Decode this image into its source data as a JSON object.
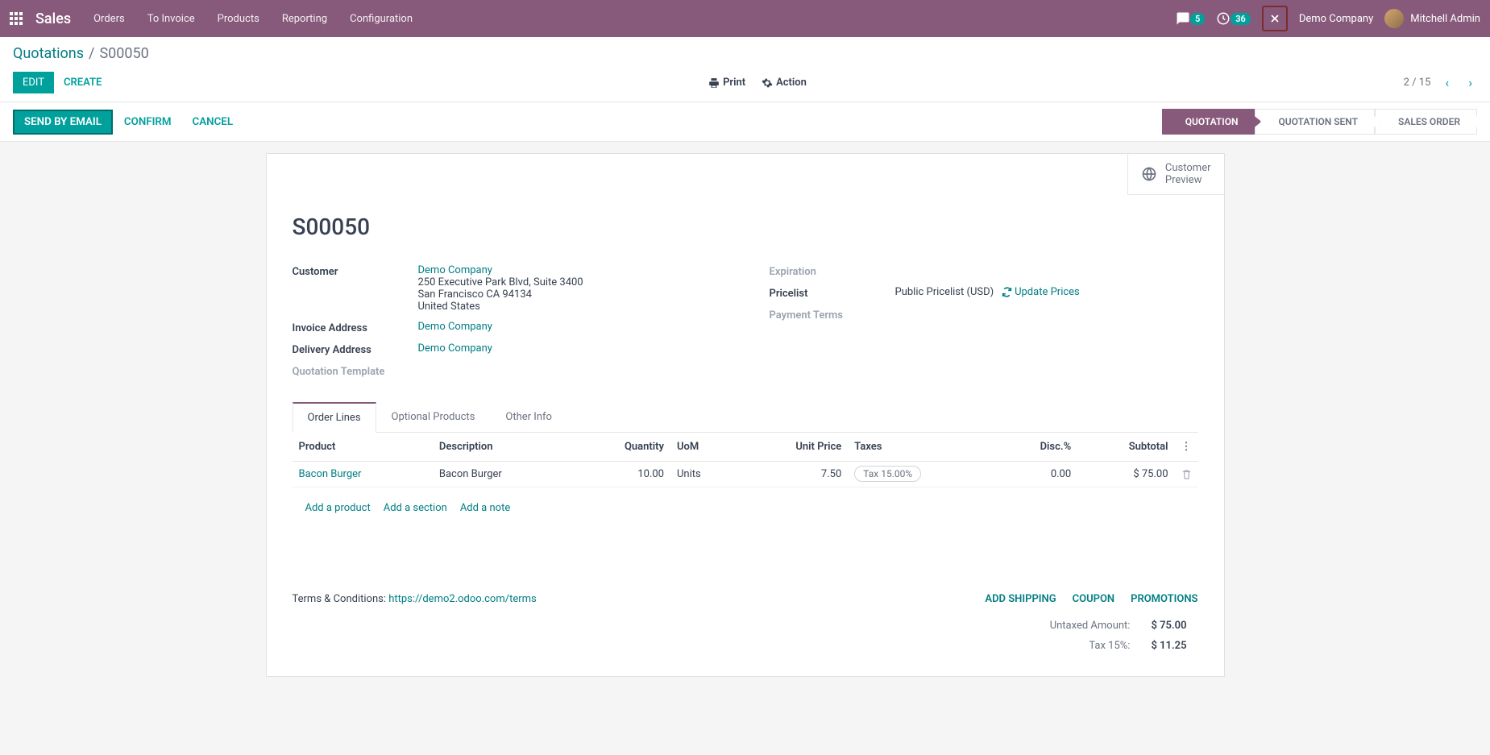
{
  "navbar": {
    "app": "Sales",
    "menu": [
      "Orders",
      "To Invoice",
      "Products",
      "Reporting",
      "Configuration"
    ],
    "msg_count": "5",
    "activity_count": "36",
    "company": "Demo Company",
    "user": "Mitchell Admin"
  },
  "breadcrumb": {
    "parent": "Quotations",
    "sep": "/",
    "current": "S00050"
  },
  "buttons": {
    "edit": "EDIT",
    "create": "CREATE",
    "print": "Print",
    "action": "Action"
  },
  "pager": {
    "text": "2 / 15"
  },
  "status": {
    "send": "SEND BY EMAIL",
    "confirm": "CONFIRM",
    "cancel": "CANCEL",
    "steps": [
      "QUOTATION",
      "QUOTATION SENT",
      "SALES ORDER"
    ]
  },
  "preview": {
    "label1": "Customer",
    "label2": "Preview"
  },
  "record": {
    "name": "S00050",
    "customer_label": "Customer",
    "customer": "Demo Company",
    "addr1": "250 Executive Park Blvd, Suite 3400",
    "addr2": "San Francisco CA 94134",
    "addr3": "United States",
    "invoice_addr_label": "Invoice Address",
    "invoice_addr": "Demo Company",
    "delivery_addr_label": "Delivery Address",
    "delivery_addr": "Demo Company",
    "template_label": "Quotation Template",
    "expiration_label": "Expiration",
    "pricelist_label": "Pricelist",
    "pricelist": "Public Pricelist (USD)",
    "update_prices": "Update Prices",
    "payment_terms_label": "Payment Terms"
  },
  "tabs": [
    "Order Lines",
    "Optional Products",
    "Other Info"
  ],
  "table": {
    "headers": {
      "product": "Product",
      "desc": "Description",
      "qty": "Quantity",
      "uom": "UoM",
      "price": "Unit Price",
      "taxes": "Taxes",
      "disc": "Disc.%",
      "subtotal": "Subtotal"
    },
    "row": {
      "product": "Bacon Burger",
      "desc": "Bacon Burger",
      "qty": "10.00",
      "uom": "Units",
      "price": "7.50",
      "tax": "Tax 15.00%",
      "disc": "0.00",
      "subtotal": "$ 75.00"
    },
    "add_product": "Add a product",
    "add_section": "Add a section",
    "add_note": "Add a note"
  },
  "terms": {
    "prefix": "Terms & Conditions: ",
    "link": "https://demo2.odoo.com/terms"
  },
  "totals": {
    "shipping": "ADD SHIPPING",
    "coupon": "COUPON",
    "promo": "PROMOTIONS",
    "untaxed_label": "Untaxed Amount:",
    "untaxed": "$ 75.00",
    "tax_label": "Tax 15%:",
    "tax": "$ 11.25"
  }
}
